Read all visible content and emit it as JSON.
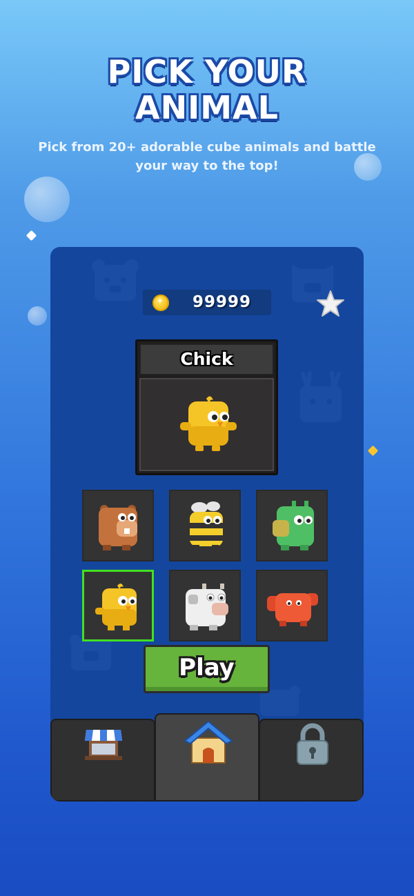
{
  "header": {
    "title_line1": "PICK YOUR",
    "title_line2": "ANIMAL",
    "subtitle": "Pick from 20+ adorable cube animals and battle your way to the top!"
  },
  "currency": {
    "coins": "99999",
    "icon": "coin-icon"
  },
  "selected_animal": {
    "name": "Chick"
  },
  "animals": [
    {
      "name": "beaver",
      "icon": "beaver-icon",
      "selected": false
    },
    {
      "name": "bee",
      "icon": "bee-icon",
      "selected": false
    },
    {
      "name": "frog",
      "icon": "frog-icon",
      "selected": false
    },
    {
      "name": "chick",
      "icon": "chick-icon",
      "selected": true
    },
    {
      "name": "cow",
      "icon": "cow-icon",
      "selected": false
    },
    {
      "name": "crab",
      "icon": "crab-icon",
      "selected": false
    }
  ],
  "play_button": {
    "label": "Play"
  },
  "tabs": [
    {
      "name": "shop",
      "icon": "shop-icon",
      "active": false
    },
    {
      "name": "home",
      "icon": "home-icon",
      "active": true
    },
    {
      "name": "locked",
      "icon": "lock-icon",
      "active": false
    }
  ],
  "colors": {
    "selected_border": "#43e021",
    "play_green": "#67b43c",
    "panel_blue": "#14469e"
  }
}
